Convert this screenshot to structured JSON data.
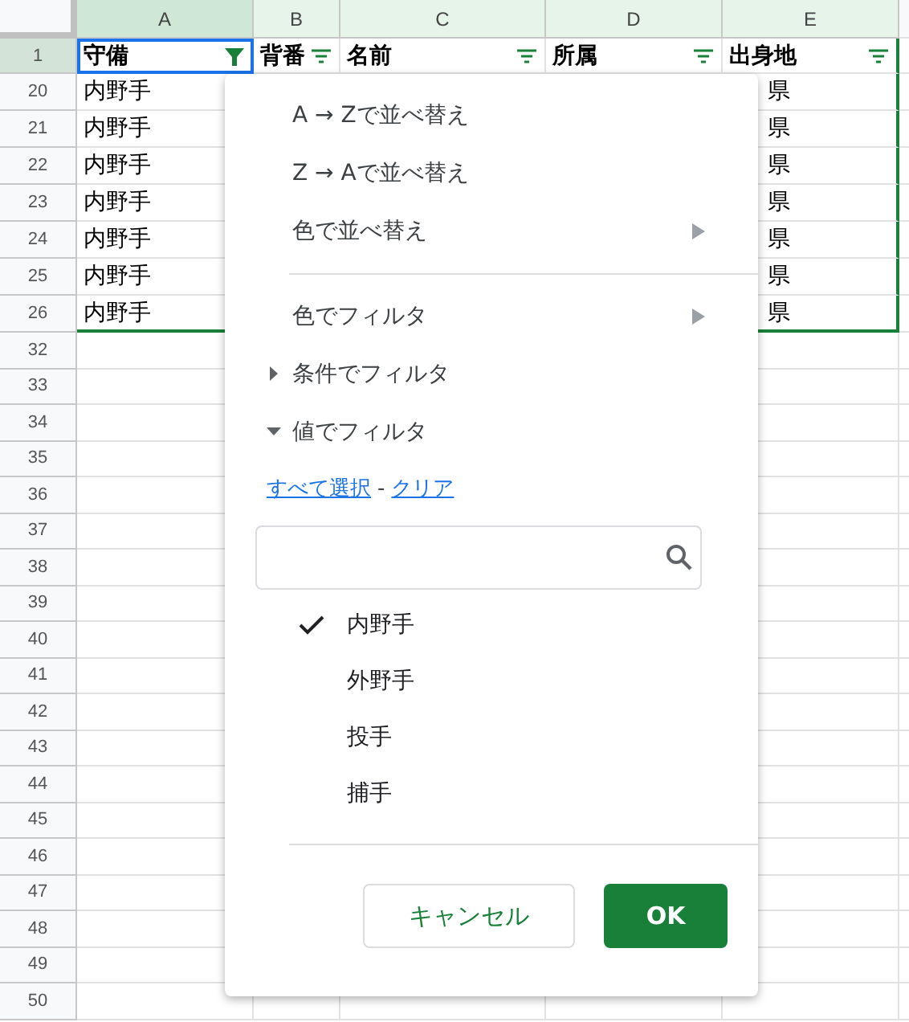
{
  "columns": [
    {
      "label": "A",
      "selected": true
    },
    {
      "label": "B",
      "selected": false
    },
    {
      "label": "C",
      "selected": false
    },
    {
      "label": "D",
      "selected": false
    },
    {
      "label": "E",
      "selected": false
    }
  ],
  "header_row": {
    "row_number": "1",
    "cells": [
      {
        "text": "守備",
        "filter_active": true
      },
      {
        "text": "背番",
        "filter_active": false
      },
      {
        "text": "名前",
        "filter_active": false
      },
      {
        "text": "所属",
        "filter_active": false
      },
      {
        "text": "出身地",
        "filter_active": false
      }
    ]
  },
  "rows": [
    {
      "row_number": "20",
      "column_a": "内野手",
      "column_e": "県"
    },
    {
      "row_number": "21",
      "column_a": "内野手",
      "column_e": "県"
    },
    {
      "row_number": "22",
      "column_a": "内野手",
      "column_e": "県"
    },
    {
      "row_number": "23",
      "column_a": "内野手",
      "column_e": "県"
    },
    {
      "row_number": "24",
      "column_a": "内野手",
      "column_e": "県"
    },
    {
      "row_number": "25",
      "column_a": "内野手",
      "column_e": "県"
    },
    {
      "row_number": "26",
      "column_a": "内野手",
      "column_e": "県"
    },
    {
      "row_number": "32"
    },
    {
      "row_number": "33"
    },
    {
      "row_number": "34"
    },
    {
      "row_number": "35"
    },
    {
      "row_number": "36"
    },
    {
      "row_number": "37"
    },
    {
      "row_number": "38"
    },
    {
      "row_number": "39"
    },
    {
      "row_number": "40"
    },
    {
      "row_number": "41"
    },
    {
      "row_number": "42"
    },
    {
      "row_number": "43"
    },
    {
      "row_number": "44"
    },
    {
      "row_number": "45"
    },
    {
      "row_number": "46"
    },
    {
      "row_number": "47"
    },
    {
      "row_number": "48"
    },
    {
      "row_number": "49"
    },
    {
      "row_number": "50"
    }
  ],
  "filter_menu": {
    "sort_items": [
      {
        "label": "A → Zで並べ替え",
        "has_submenu": false
      },
      {
        "label": "Z → Aで並べ替え",
        "has_submenu": false
      },
      {
        "label": "色で並べ替え",
        "has_submenu": true
      }
    ],
    "filter_items": [
      {
        "kind": "submenu",
        "label": "色でフィルタ"
      },
      {
        "kind": "section",
        "label": "条件でフィルタ",
        "expanded": false
      },
      {
        "kind": "section",
        "label": "値でフィルタ",
        "expanded": true
      }
    ],
    "select_all_link": "すべて選択",
    "link_separator": "-",
    "clear_link": "クリア",
    "values": [
      {
        "label": "内野手",
        "checked": true
      },
      {
        "label": "外野手",
        "checked": false
      },
      {
        "label": "投手",
        "checked": false
      },
      {
        "label": "捕手",
        "checked": false
      }
    ],
    "cancel_button": "キャンセル",
    "ok_button": "OK"
  }
}
